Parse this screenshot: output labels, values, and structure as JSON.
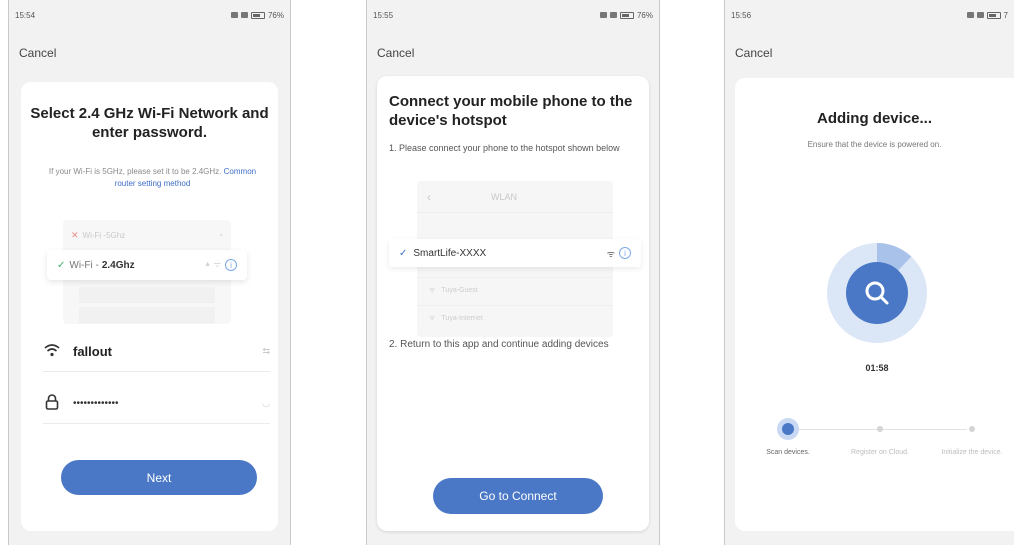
{
  "screens": [
    {
      "status_time": "15:54",
      "status_battery": "76%",
      "cancel": "Cancel",
      "title": "Select 2.4 GHz Wi-Fi Network and enter password.",
      "subtitle": "If your Wi-Fi is 5GHz, please set it to be 2.4GHz.",
      "subtitle_link": "Common router setting method",
      "wifi_bad_prefix": "Wi-Fi - ",
      "wifi_bad_band": "5Ghz",
      "wifi_good_prefix": "Wi-Fi - ",
      "wifi_good_band": "2.4Ghz",
      "ssid": "fallout",
      "ssid_trail": "⇆",
      "password": "•••••••••••••",
      "next_label": "Next"
    },
    {
      "status_time": "15:55",
      "status_battery": "76%",
      "cancel": "Cancel",
      "title": "Connect your mobile phone to the device's hotspot",
      "step1": "1. Please connect your phone to the hotspot shown below",
      "wlan_header": "WLAN",
      "wlan_selected": "SmartLife-XXXX",
      "wlan_item_1": "Tuya-Guest",
      "wlan_item_2": "Tuya-Internet",
      "step2": "2. Return to this app and continue adding devices",
      "connect_label": "Go to Connect"
    },
    {
      "status_time": "15:56",
      "status_battery": "7",
      "cancel": "Cancel",
      "title": "Adding device...",
      "subtitle": "Ensure that the device is powered on.",
      "timer": "01:58",
      "progress_fraction": 0.12,
      "steps": [
        "Scan devices.",
        "Register on Cloud.",
        "Initialize the device."
      ]
    }
  ],
  "colors": {
    "accent": "#4a78c6",
    "link": "#3d6cc8",
    "check_green": "#37b46a",
    "error_red": "#e88b8b"
  },
  "icons": {
    "wifi": "wifi-icon",
    "lock": "lock-icon",
    "check": "check-icon",
    "search": "search-icon",
    "back": "chevron-left-icon",
    "info": "info-icon"
  }
}
